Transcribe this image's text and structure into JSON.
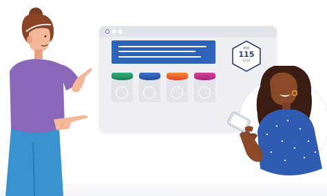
{
  "badge": {
    "label": "PIX",
    "value": "115",
    "sub": "1024",
    "border_color": "#2d3a6e"
  },
  "product_cards": [
    {
      "color": "#2e9a6e"
    },
    {
      "color": "#2f63b7"
    },
    {
      "color": "#ec5a2b"
    },
    {
      "color": "#c2348e"
    }
  ],
  "colors": {
    "hero_panel": "#2f63b7",
    "browser_bg": "#eeeff3",
    "left_shirt": "#8b67b9",
    "left_jeans": "#3a92cf",
    "right_shirt": "#2f5bb0",
    "circle_bg": "#ffffff"
  },
  "icons": [
    "browser-window",
    "phone-icon"
  ]
}
